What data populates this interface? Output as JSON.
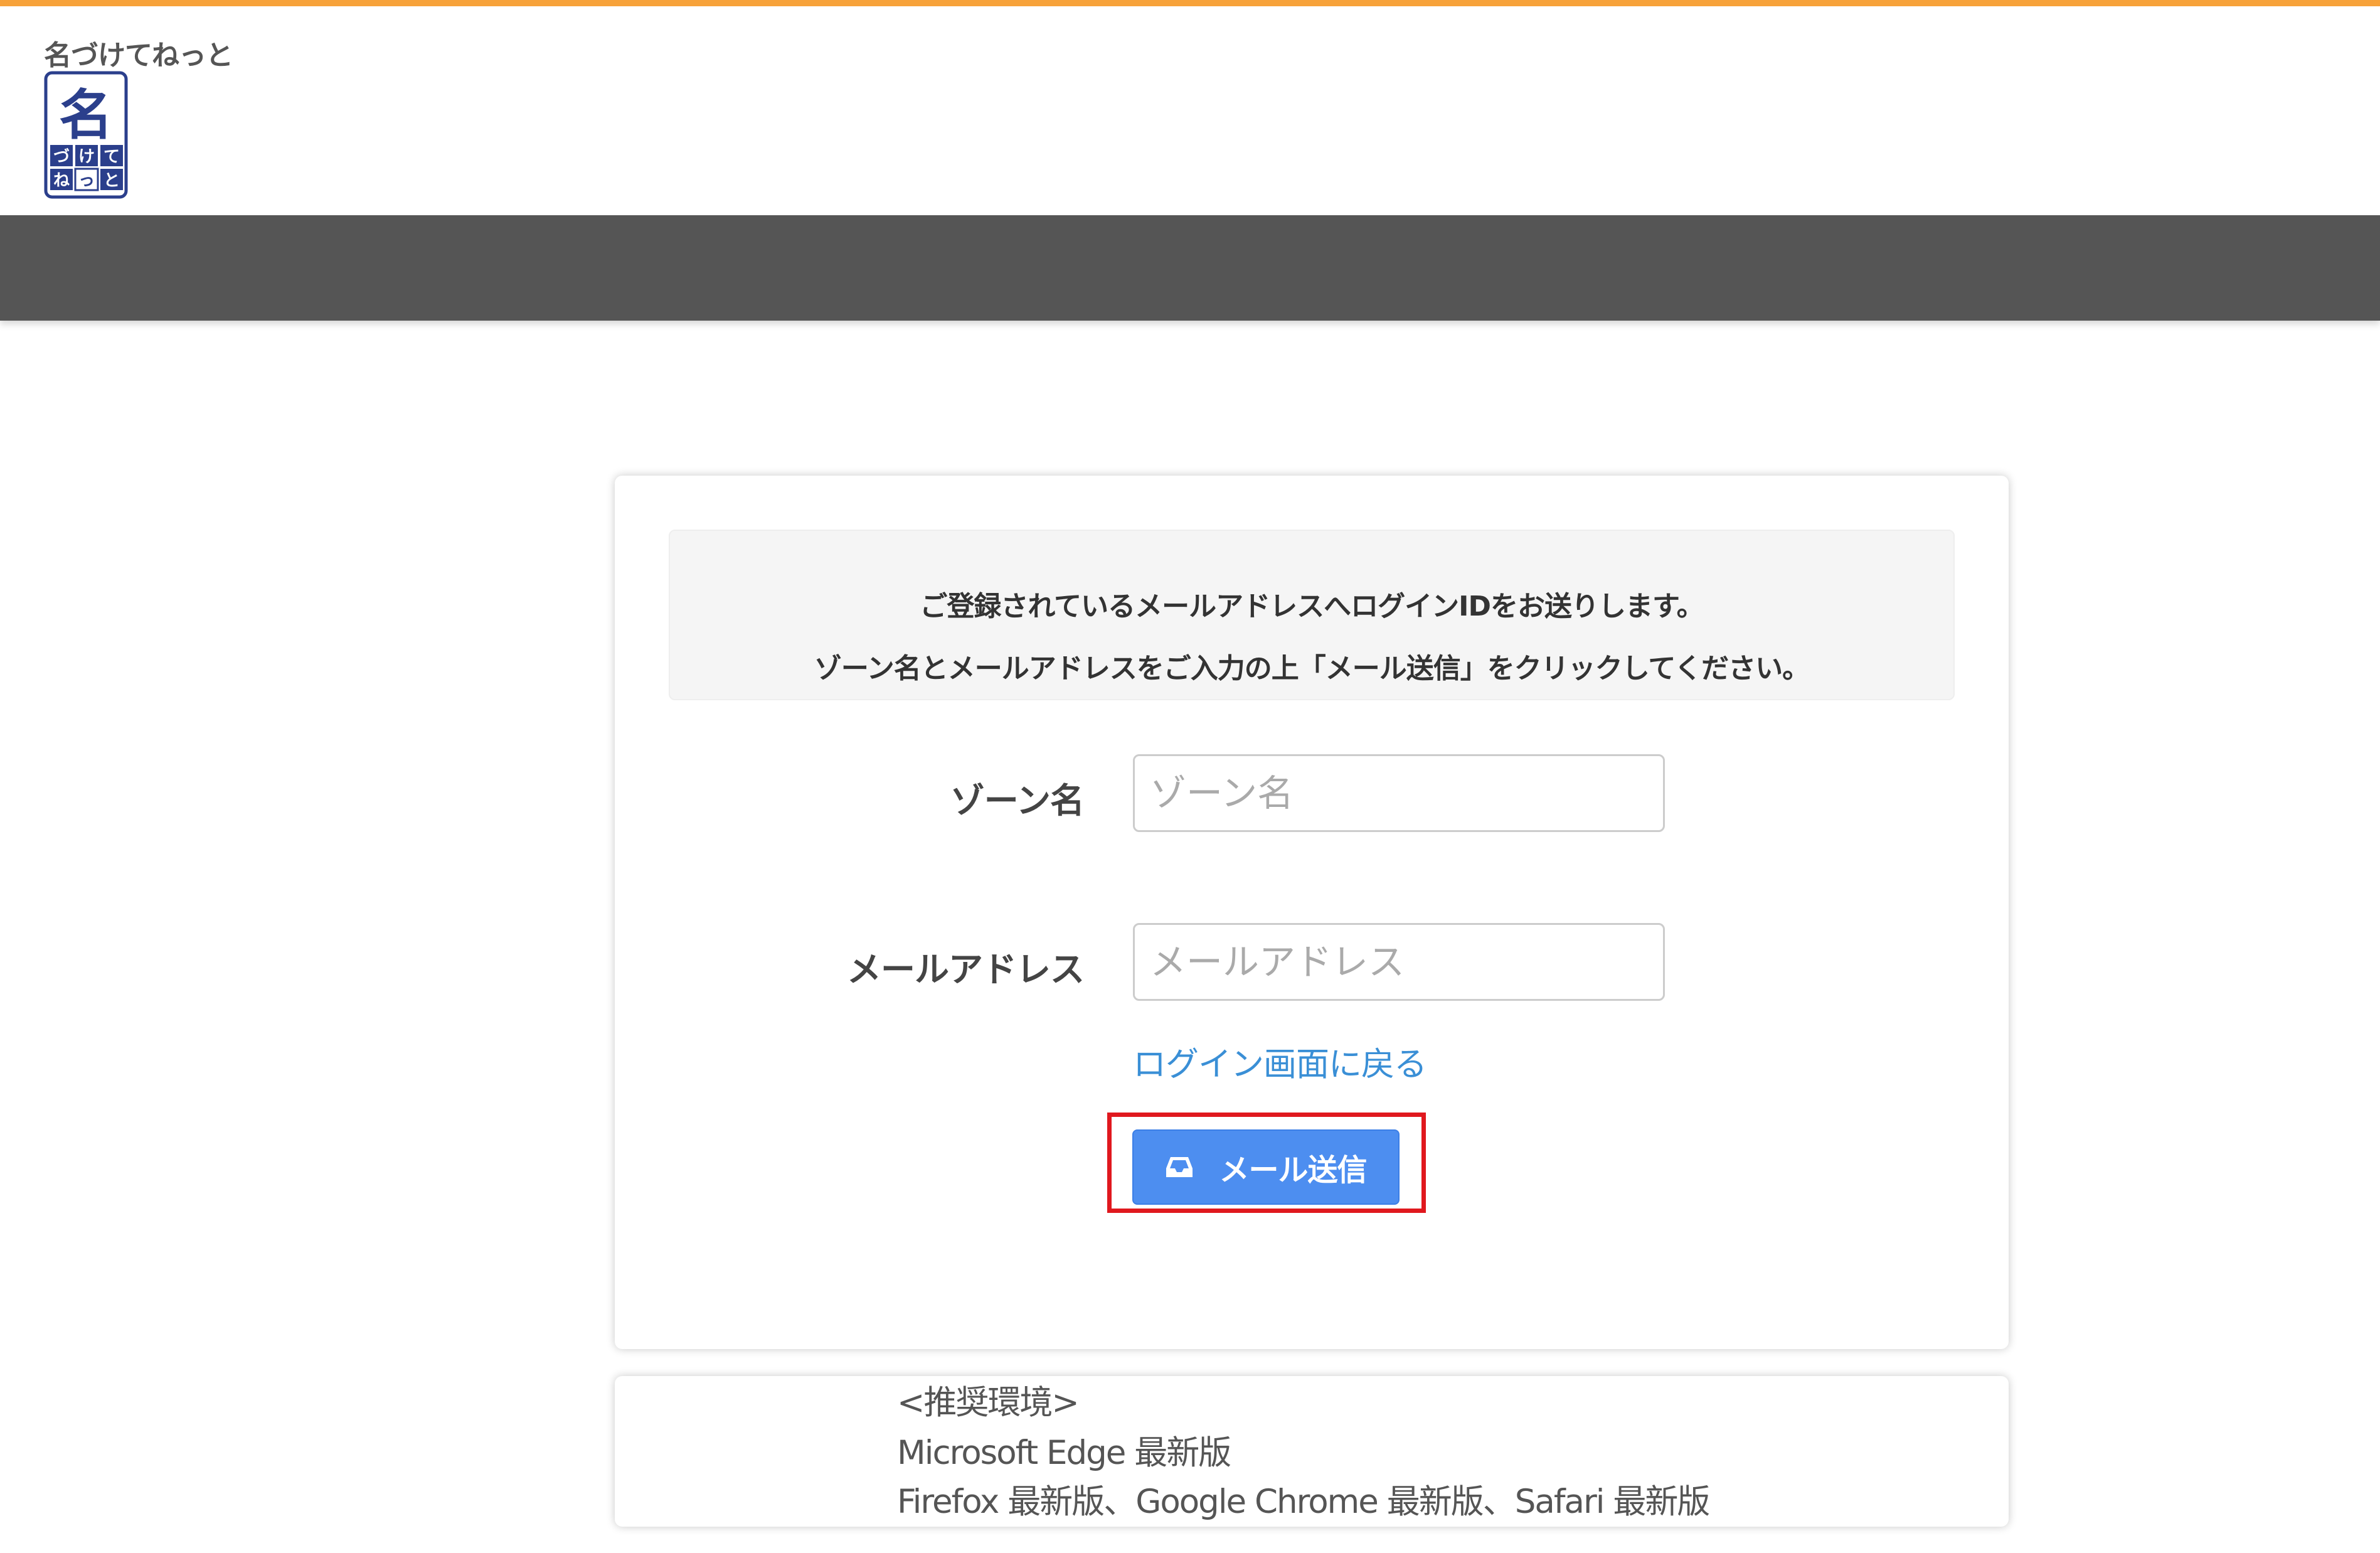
{
  "header": {
    "brand_name": "名づけてねっと",
    "logo": {
      "main_char": "名",
      "row1": [
        "づ",
        "け",
        "て"
      ],
      "row2": [
        "ね",
        "っ",
        "と"
      ]
    }
  },
  "colors": {
    "accent": "#f7a23a",
    "nav_band": "#555555",
    "button": "#4d8ef0",
    "link": "#3a8fd6",
    "highlight": "#e0181e",
    "logo_blue": "#2b3f8c"
  },
  "form": {
    "notice_line1": "ご登録されているメールアドレスへログインIDをお送りします。",
    "notice_line2": "ゾーン名とメールアドレスをご入力の上「メール送信」をクリックしてください。",
    "zone_label": "ゾーン名",
    "zone_placeholder": "ゾーン名",
    "email_label": "メールアドレス",
    "email_placeholder": "メールアドレス",
    "back_link": "ログイン画面に戻る",
    "send_button_label": "メール送信",
    "send_button_icon": "inbox-icon"
  },
  "recommended_env": {
    "heading": "<推奨環境>",
    "line1": "Microsoft Edge 最新版",
    "line2": "Firefox 最新版、Google Chrome 最新版、Safari 最新版"
  }
}
